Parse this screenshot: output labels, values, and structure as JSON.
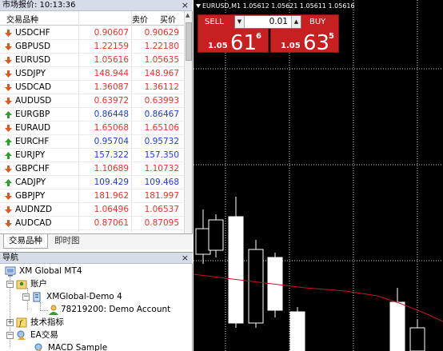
{
  "market_watch": {
    "title": "市场报价: 10:13:36",
    "close": "×",
    "columns": {
      "symbol": "交易品种",
      "bid": "卖价",
      "ask": "买价"
    },
    "rows": [
      {
        "symbol": "USDCHF",
        "bid": "0.90607",
        "ask": "0.90629",
        "dir": "down",
        "color": "#e8322a"
      },
      {
        "symbol": "GBPUSD",
        "bid": "1.22159",
        "ask": "1.22180",
        "dir": "down",
        "color": "#e8322a"
      },
      {
        "symbol": "EURUSD",
        "bid": "1.05616",
        "ask": "1.05635",
        "dir": "down",
        "color": "#e8322a"
      },
      {
        "symbol": "USDJPY",
        "bid": "148.944",
        "ask": "148.967",
        "dir": "down",
        "color": "#e8322a"
      },
      {
        "symbol": "USDCAD",
        "bid": "1.36087",
        "ask": "1.36112",
        "dir": "down",
        "color": "#e8322a"
      },
      {
        "symbol": "AUDUSD",
        "bid": "0.63972",
        "ask": "0.63993",
        "dir": "down",
        "color": "#e8322a"
      },
      {
        "symbol": "EURGBP",
        "bid": "0.86448",
        "ask": "0.86467",
        "dir": "up",
        "color": "#1f3bd8"
      },
      {
        "symbol": "EURAUD",
        "bid": "1.65068",
        "ask": "1.65106",
        "dir": "down",
        "color": "#e8322a"
      },
      {
        "symbol": "EURCHF",
        "bid": "0.95704",
        "ask": "0.95732",
        "dir": "up",
        "color": "#1f3bd8"
      },
      {
        "symbol": "EURJPY",
        "bid": "157.322",
        "ask": "157.350",
        "dir": "up",
        "color": "#1f3bd8"
      },
      {
        "symbol": "GBPCHF",
        "bid": "1.10689",
        "ask": "1.10732",
        "dir": "down",
        "color": "#e8322a"
      },
      {
        "symbol": "CADJPY",
        "bid": "109.429",
        "ask": "109.468",
        "dir": "up",
        "color": "#1f3bd8"
      },
      {
        "symbol": "GBPJPY",
        "bid": "181.962",
        "ask": "181.997",
        "dir": "down",
        "color": "#e8322a"
      },
      {
        "symbol": "AUDNZD",
        "bid": "1.06496",
        "ask": "1.06537",
        "dir": "down",
        "color": "#e8322a"
      },
      {
        "symbol": "AUDCAD",
        "bid": "0.87061",
        "ask": "0.87095",
        "dir": "down",
        "color": "#e8322a"
      }
    ],
    "tabs": [
      "交易品种",
      "即时图"
    ]
  },
  "navigator": {
    "title": "导航",
    "close": "×",
    "root": "XM Global MT4",
    "accounts": "账户",
    "server": "XMGlobal-Demo 4",
    "account": "78219200: Demo Account",
    "indicators": "技术指标",
    "experts": "EA交易",
    "macd": "MACD Sample"
  },
  "chart": {
    "title": "EURUSD,M1  1.05612 1.05621 1.05611 1.05616",
    "sell_label": "SELL",
    "buy_label": "BUY",
    "lot": "0.01",
    "sell_price_small": "1.05",
    "sell_price_big": "61",
    "sell_price_sup": "6",
    "buy_price_small": "1.05",
    "buy_price_big": "63",
    "buy_price_sup": "5",
    "colors": {
      "up_arrow": "#2e9e2e",
      "down_arrow": "#e0561b",
      "trade_button": "#c62020",
      "candle_bull": "#000000",
      "candle_bear": "#ffffff",
      "ma_line": "#c8102e"
    }
  }
}
